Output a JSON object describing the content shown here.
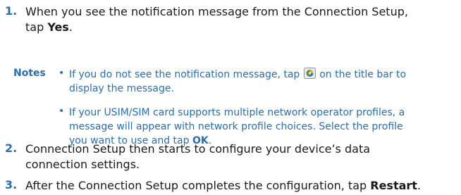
{
  "steps": [
    {
      "number": "1.",
      "text_a": "When you see the notification message from the Connection Setup,",
      "text_b": "tap ",
      "bold": "Yes",
      "text_c": "."
    },
    {
      "number": "2.",
      "text_a": "Connection Setup then starts to configure your device’s data",
      "text_b": "connection settings."
    },
    {
      "number": "3.",
      "text_a": "After the Connection Setup completes the configuration, tap ",
      "bold": "Restart",
      "text_c": "."
    }
  ],
  "notes": {
    "label": "Notes",
    "bullet": "•",
    "items": [
      {
        "text_a": "If you do not see the notification message, tap ",
        "icon": "connection-setup-icon",
        "text_b": " on the title bar to",
        "text_c": "display the message."
      },
      {
        "text_a": "If your USIM/SIM card supports multiple network operator profiles, a",
        "text_b": "message will appear with network profile choices. Select the profile",
        "text_c": "you want to use and tap ",
        "bold": "OK",
        "text_d": "."
      }
    ]
  },
  "colors": {
    "accent": "#2b6db3",
    "text": "#1a1a1a"
  }
}
